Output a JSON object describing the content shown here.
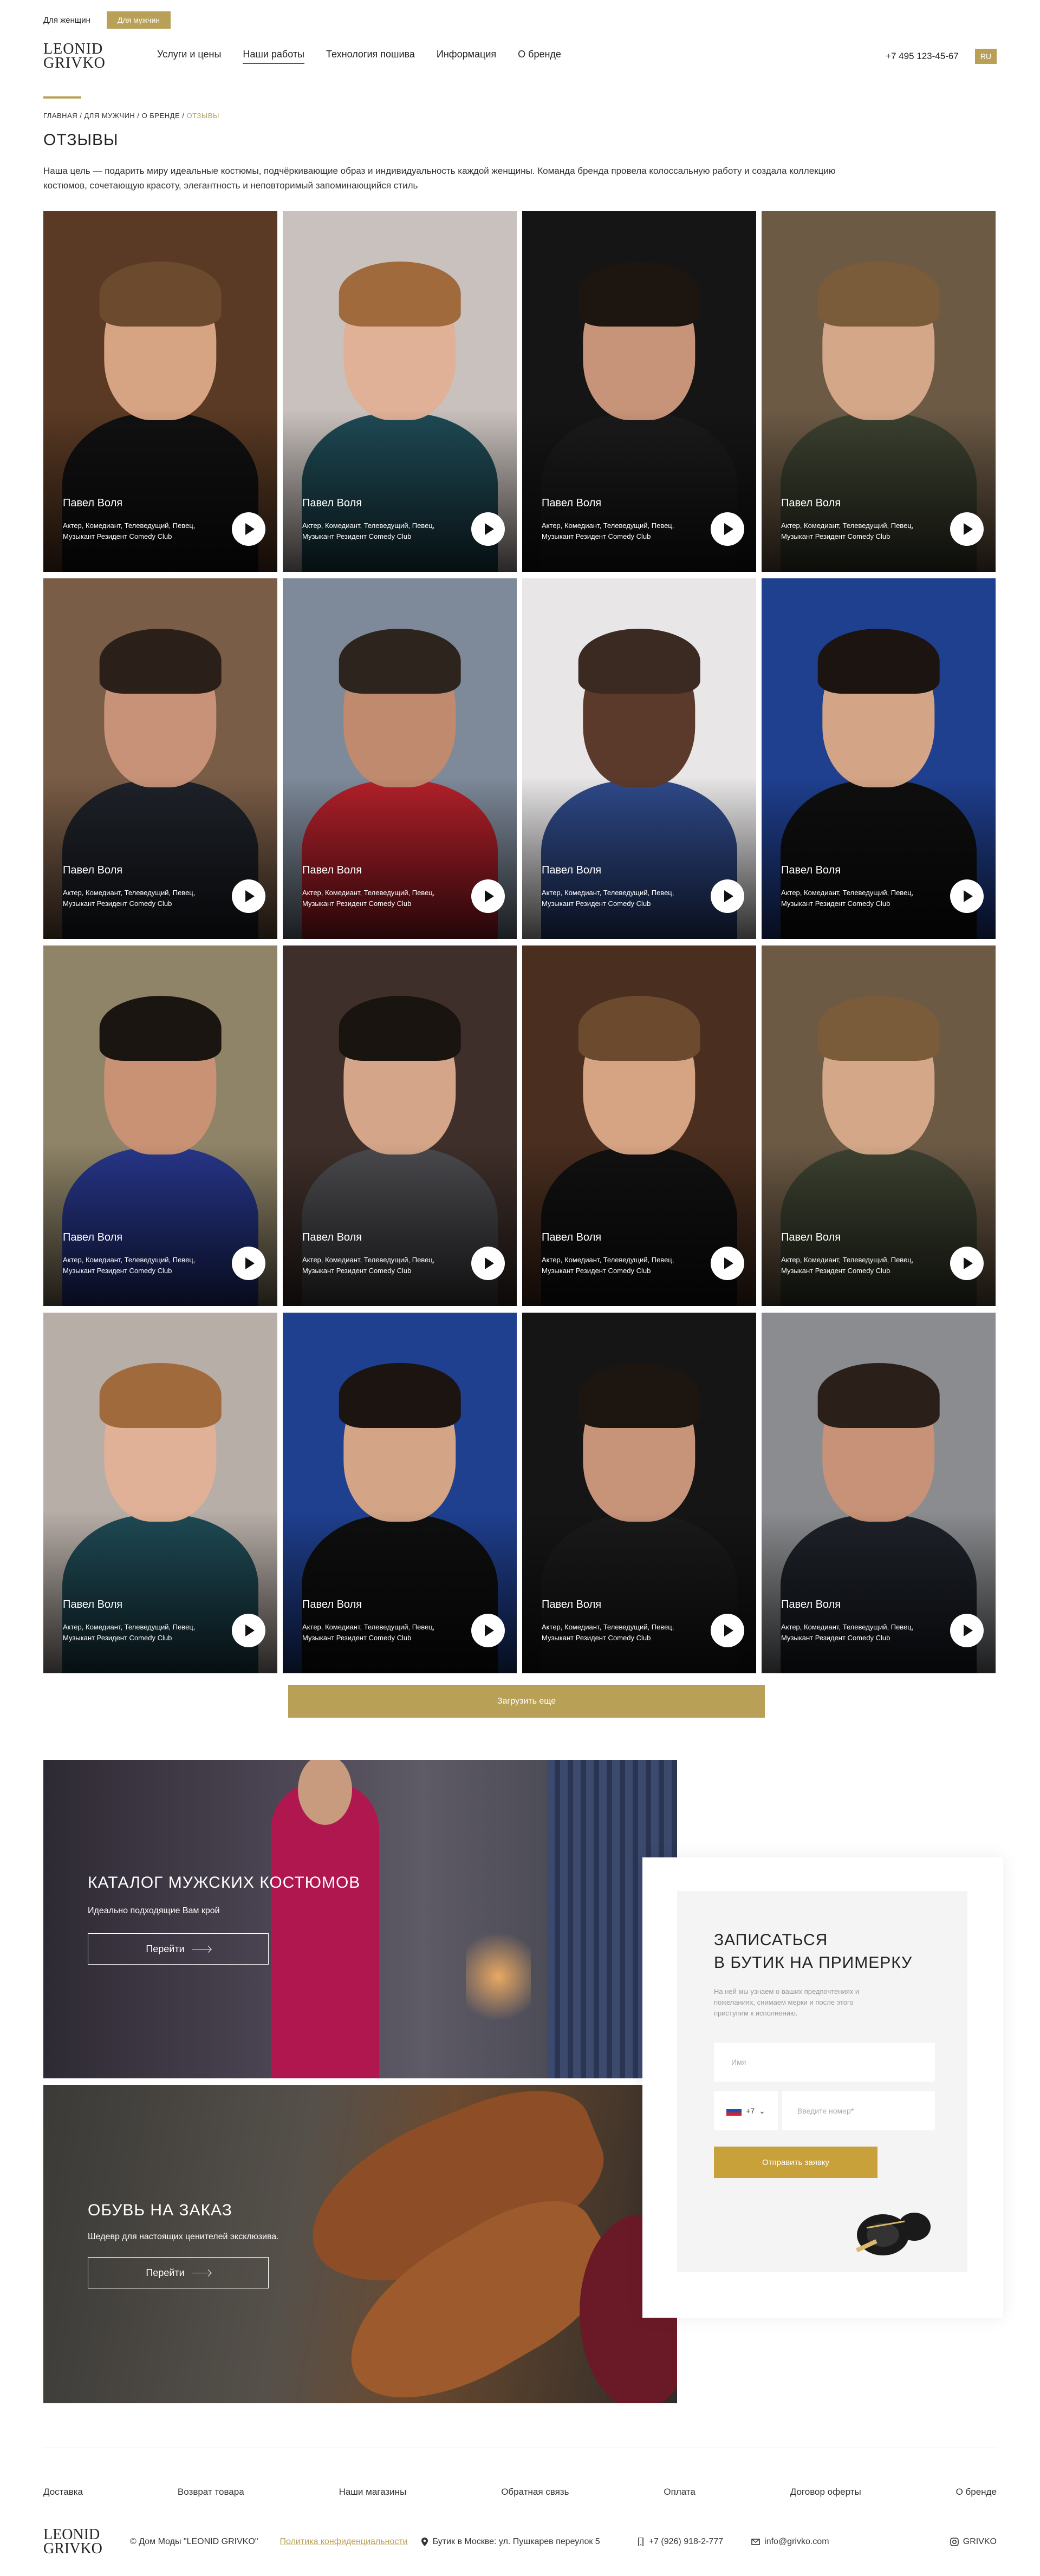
{
  "topbar": {
    "women": "Для женщин",
    "men": "Для мужчин"
  },
  "header": {
    "logo_line1": "LEONID",
    "logo_line2": "GRIVKO",
    "nav": [
      "Услуги и цены",
      "Наши работы",
      "Технология пошива",
      "Информация",
      "О бренде"
    ],
    "phone": "+7 495 123-45-67",
    "lang": "RU"
  },
  "breadcrumbs": {
    "home": "ГЛАВНАЯ",
    "men": "ДЛЯ МУЖЧИН",
    "brand": "О БРЕНДЕ",
    "current": "ОТЗЫВЫ",
    "sep": " / "
  },
  "page": {
    "title": "ОТЗЫВЫ",
    "intro": "Наша цель — подарить миру идеальные костюмы, подчёркивающие образ и индивидуальность каждой женщины. Команда бренда провела колоссальную работу и создала коллекцию костюмов, сочетающую красоту, элегантность и неповторимый запоминающийся стиль"
  },
  "reviews": [
    {
      "name": "Павел Воля",
      "desc": "Актер, Комедиант, Телеведущий, Певец, Музыкант Резидент Comedy Club",
      "bg": "#5a3a24",
      "skin": "#d6a383",
      "hair": "#6b4a2e",
      "suit": "#111111"
    },
    {
      "name": "Павел Воля",
      "desc": "Актер, Комедиант, Телеведущий, Певец, Музыкант Резидент Comedy Club",
      "bg": "#c9c1bd",
      "skin": "#e0b197",
      "hair": "#a06a3c",
      "suit": "#1f4a55"
    },
    {
      "name": "Павел Воля",
      "desc": "Актер, Комедиант, Телеведущий, Певец, Музыкант Резидент Comedy Club",
      "bg": "#151515",
      "skin": "#c89479",
      "hair": "#1c1510",
      "suit": "#1a1a1a"
    },
    {
      "name": "Павел Воля",
      "desc": "Актер, Комедиант, Телеведущий, Певец, Музыкант Резидент Comedy Club",
      "bg": "#6c5a45",
      "skin": "#d4a789",
      "hair": "#7a5b3a",
      "suit": "#3c4130"
    },
    {
      "name": "Павел Воля",
      "desc": "Актер, Комедиант, Телеведущий, Певец, Музыкант Резидент Comedy Club",
      "bg": "#7a5d47",
      "skin": "#c79277",
      "hair": "#2b2019",
      "suit": "#1e2229"
    },
    {
      "name": "Павел Воля",
      "desc": "Актер, Комедиант, Телеведущий, Певец, Музыкант Резидент Comedy Club",
      "bg": "#7e8a9a",
      "skin": "#c08a6e",
      "hair": "#2d241e",
      "suit": "#b3202a"
    },
    {
      "name": "Павел Воля",
      "desc": "Актер, Комедиант, Телеведущий, Певец, Музыкант Резидент Comedy Club",
      "bg": "#e8e6e6",
      "skin": "#5b3a2c",
      "hair": "#3a2a22",
      "suit": "#2f4a8a"
    },
    {
      "name": "Павел Воля",
      "desc": "Актер, Комедиант, Телеведущий, Певец, Музыкант Резидент Comedy Club",
      "bg": "#1f3f8f",
      "skin": "#d3a486",
      "hair": "#1b1410",
      "suit": "#0f0f0f"
    },
    {
      "name": "Павел Воля",
      "desc": "Актер, Комедиант, Телеведущий, Певец, Музыкант Резидент Comedy Club",
      "bg": "#8f8468",
      "skin": "#c99274",
      "hair": "#1b1512",
      "suit": "#27368a"
    },
    {
      "name": "Павел Воля",
      "desc": "Актер, Комедиант, Телеведущий, Певец, Музыкант Резидент Comedy Club",
      "bg": "#3f2f2a",
      "skin": "#d4a588",
      "hair": "#1a1410",
      "suit": "#4a4a4e"
    },
    {
      "name": "Павел Воля",
      "desc": "Актер, Комедиант, Телеведущий, Певец, Музыкант Резидент Comedy Club",
      "bg": "#4a2e1f",
      "skin": "#d6a383",
      "hair": "#6b4a2e",
      "suit": "#111111"
    },
    {
      "name": "Павел Воля",
      "desc": "Актер, Комедиант, Телеведущий, Певец, Музыкант Резидент Comedy Club",
      "bg": "#6c5a45",
      "skin": "#d4a789",
      "hair": "#7a5b3a",
      "suit": "#3c4130"
    },
    {
      "name": "Павел Воля",
      "desc": "Актер, Комедиант, Телеведущий, Певец, Музыкант Резидент Comedy Club",
      "bg": "#b8aea8",
      "skin": "#e0b197",
      "hair": "#a06a3c",
      "suit": "#1f4a55"
    },
    {
      "name": "Павел Воля",
      "desc": "Актер, Комедиант, Телеведущий, Певец, Музыкант Резидент Comedy Club",
      "bg": "#1f3f8f",
      "skin": "#d3a486",
      "hair": "#1b1410",
      "suit": "#0f0f0f"
    },
    {
      "name": "Павел Воля",
      "desc": "Актер, Комедиант, Телеведущий, Певец, Музыкант Резидент Comedy Club",
      "bg": "#151515",
      "skin": "#c89479",
      "hair": "#1c1510",
      "suit": "#1a1a1a"
    },
    {
      "name": "Павел Воля",
      "desc": "Актер, Комедиант, Телеведущий, Певец, Музыкант Резидент Comedy Club",
      "bg": "#8a8c8f",
      "skin": "#c79277",
      "hair": "#2b2019",
      "suit": "#1e2229"
    }
  ],
  "load_more": "Загрузить еще",
  "promos": [
    {
      "title": "КАТАЛОГ МУЖСКИХ КОСТЮМОВ",
      "subtitle": "Идеально подходящие Вам крой",
      "button": "Перейти"
    },
    {
      "title": "ОБУВЬ НА ЗАКАЗ",
      "subtitle": "Шедевр для настоящих ценителей эксклюзива.",
      "button": "Перейти"
    }
  ],
  "form": {
    "title_line1": "ЗАПИСАТЬСЯ",
    "title_line2": "В БУТИК НА ПРИМЕРКУ",
    "desc": "На ней мы узнаем о ваших предпочтениях и пожеланиях, снимаем мерки и после этого приступим к исполнению.",
    "name_placeholder": "Имя",
    "country_code": "+7",
    "phone_placeholder": "Введите номер*",
    "submit": "Отправить заявку"
  },
  "footer": {
    "nav": [
      "Доставка",
      "Возврат товара",
      "Наши магазины",
      "Обратная связь",
      "Оплата",
      "Договор оферты",
      "О бренде"
    ],
    "copyright": "© Дом Моды \"LEONID GRIVKO\"",
    "privacy": "Политика конфиденциальности",
    "address": "Бутик в Москве: ул. Пушкарев переулок 5",
    "phone": "+7 (926) 918-2-777",
    "email": "info@grivko.com",
    "instagram": "GRIVKO"
  },
  "colors": {
    "accent": "#b9a057",
    "submit": "#c9a13a"
  }
}
